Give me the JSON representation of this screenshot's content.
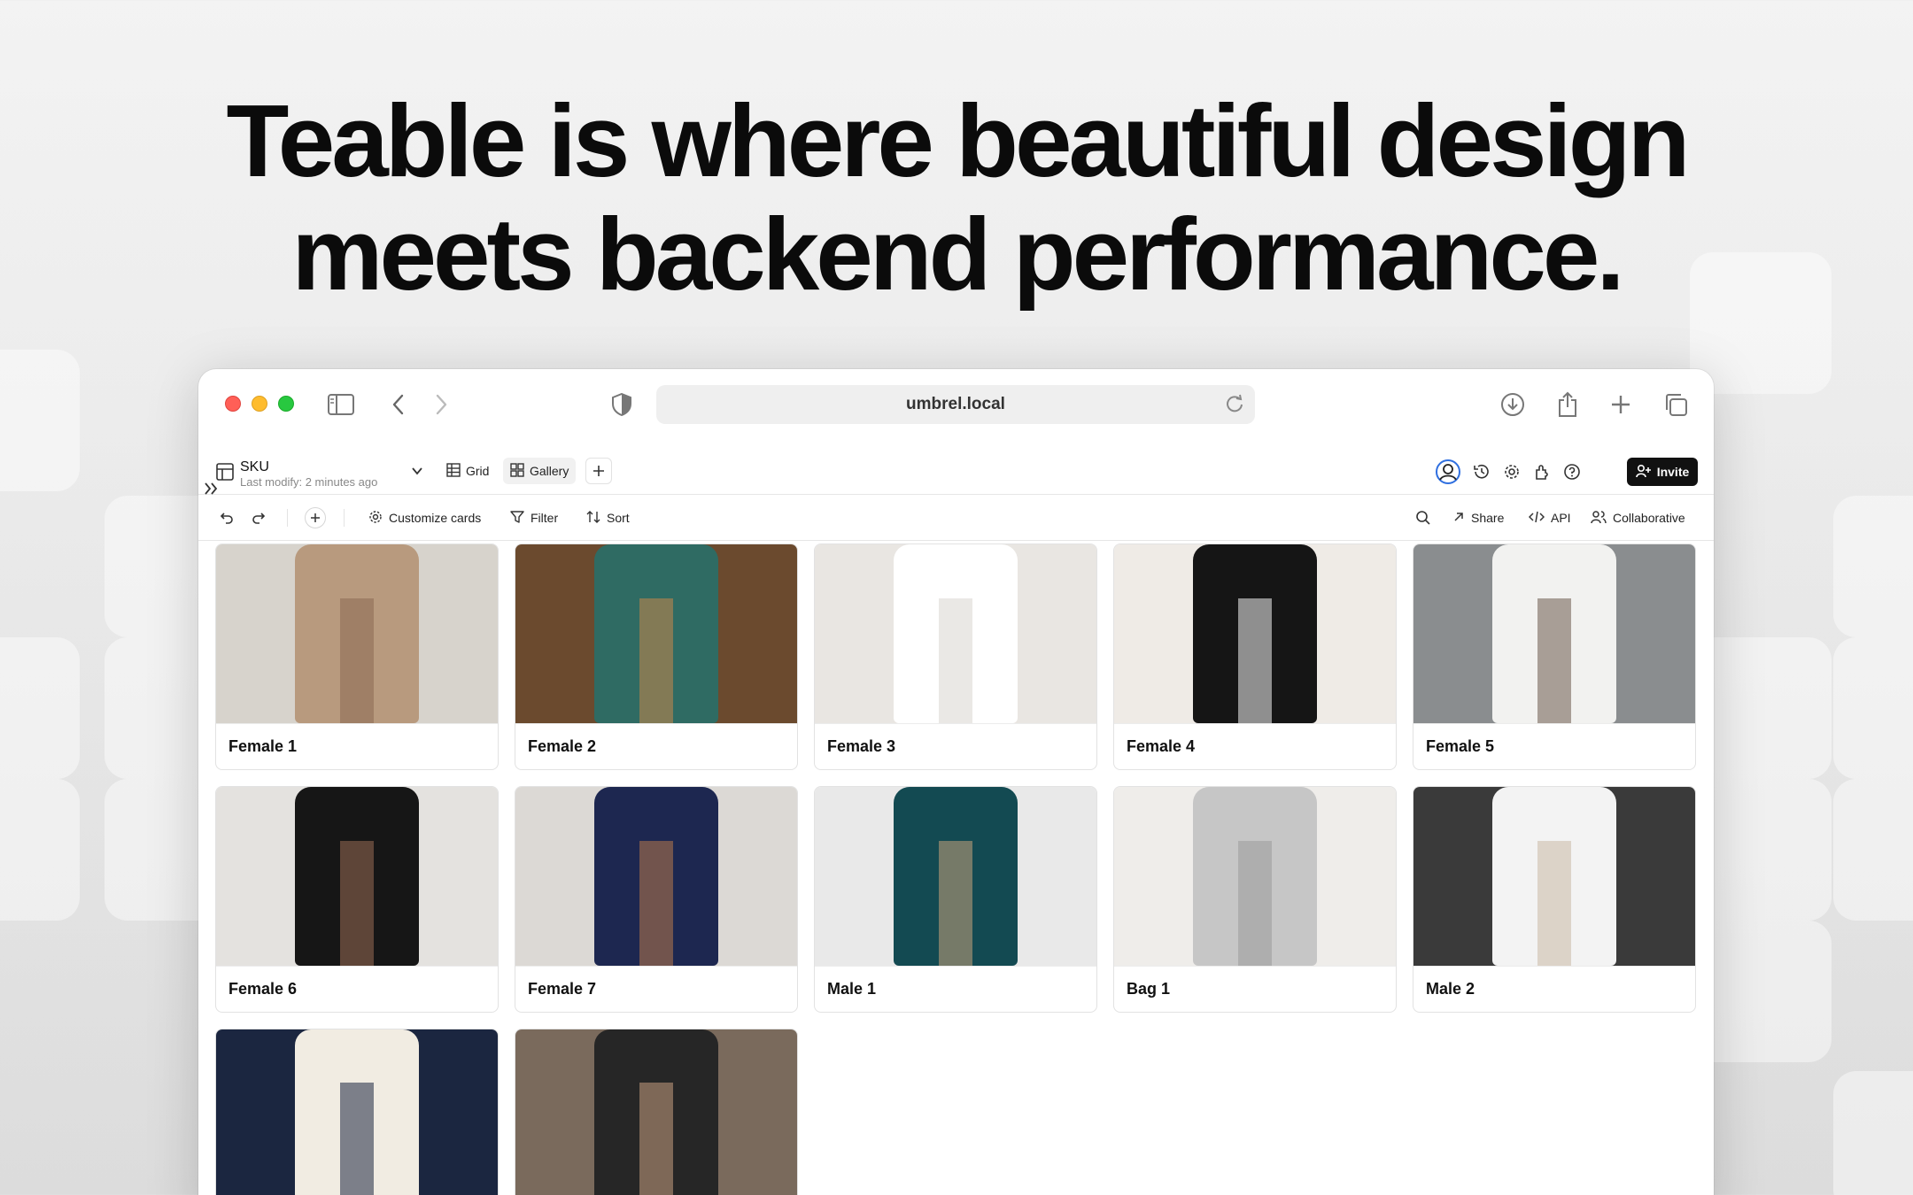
{
  "headline": {
    "line1": "Teable is where beautiful design",
    "line2": "meets backend performance."
  },
  "browser": {
    "url": "umbrel.local",
    "icons": [
      "sidebar-icon",
      "back-icon",
      "forward-icon",
      "shield-icon",
      "reload-icon",
      "download-icon",
      "share-icon",
      "new-tab-icon",
      "tabs-overview-icon"
    ]
  },
  "app": {
    "table_name": "SKU",
    "last_modify": "Last modify: 2 minutes ago",
    "views": [
      {
        "label": "Grid",
        "icon": "grid-icon",
        "active": false
      },
      {
        "label": "Gallery",
        "icon": "gallery-icon",
        "active": true
      }
    ],
    "header_icons": [
      "avatar",
      "history-icon",
      "settings-icon",
      "plugin-icon",
      "help-icon"
    ],
    "invite_label": "Invite"
  },
  "toolbar": {
    "customize_label": "Customize cards",
    "filter_label": "Filter",
    "sort_label": "Sort",
    "share_label": "Share",
    "api_label": "API",
    "collaborative_label": "Collaborative"
  },
  "cards": [
    {
      "label": "Female 1",
      "palette": [
        "#d7d3cc",
        "#b89a7e",
        "#8a6a52"
      ]
    },
    {
      "label": "Female 2",
      "palette": [
        "#6b4a2e",
        "#2f6b63",
        "#c8874a"
      ]
    },
    {
      "label": "Female 3",
      "palette": [
        "#e9e6e2",
        "#ffffff",
        "#d9d5cf"
      ]
    },
    {
      "label": "Female 4",
      "palette": [
        "#efebe6",
        "#151515",
        "#f4f4f4"
      ]
    },
    {
      "label": "Female 5",
      "palette": [
        "#8a8d8f",
        "#f2f2f0",
        "#6b5a4c"
      ]
    },
    {
      "label": "Female 6",
      "palette": [
        "#e4e2df",
        "#161616",
        "#9b6e55"
      ]
    },
    {
      "label": "Female 7",
      "palette": [
        "#dcd9d5",
        "#1d2750",
        "#b87a4b"
      ]
    },
    {
      "label": "Male 1",
      "palette": [
        "#e9e9e9",
        "#134a52",
        "#c8a27a"
      ]
    },
    {
      "label": "Bag 1",
      "palette": [
        "#efedea",
        "#c6c6c6",
        "#9a9a9a"
      ]
    },
    {
      "label": "Male 2",
      "palette": [
        "#3a3a3a",
        "#f3f3f3",
        "#c9b8a4"
      ]
    },
    {
      "label": "",
      "palette": [
        "#1b2640",
        "#f1ece2",
        "#1b2640"
      ]
    },
    {
      "label": "",
      "palette": [
        "#7a6a5c",
        "#262626",
        "#c79e80"
      ]
    }
  ]
}
